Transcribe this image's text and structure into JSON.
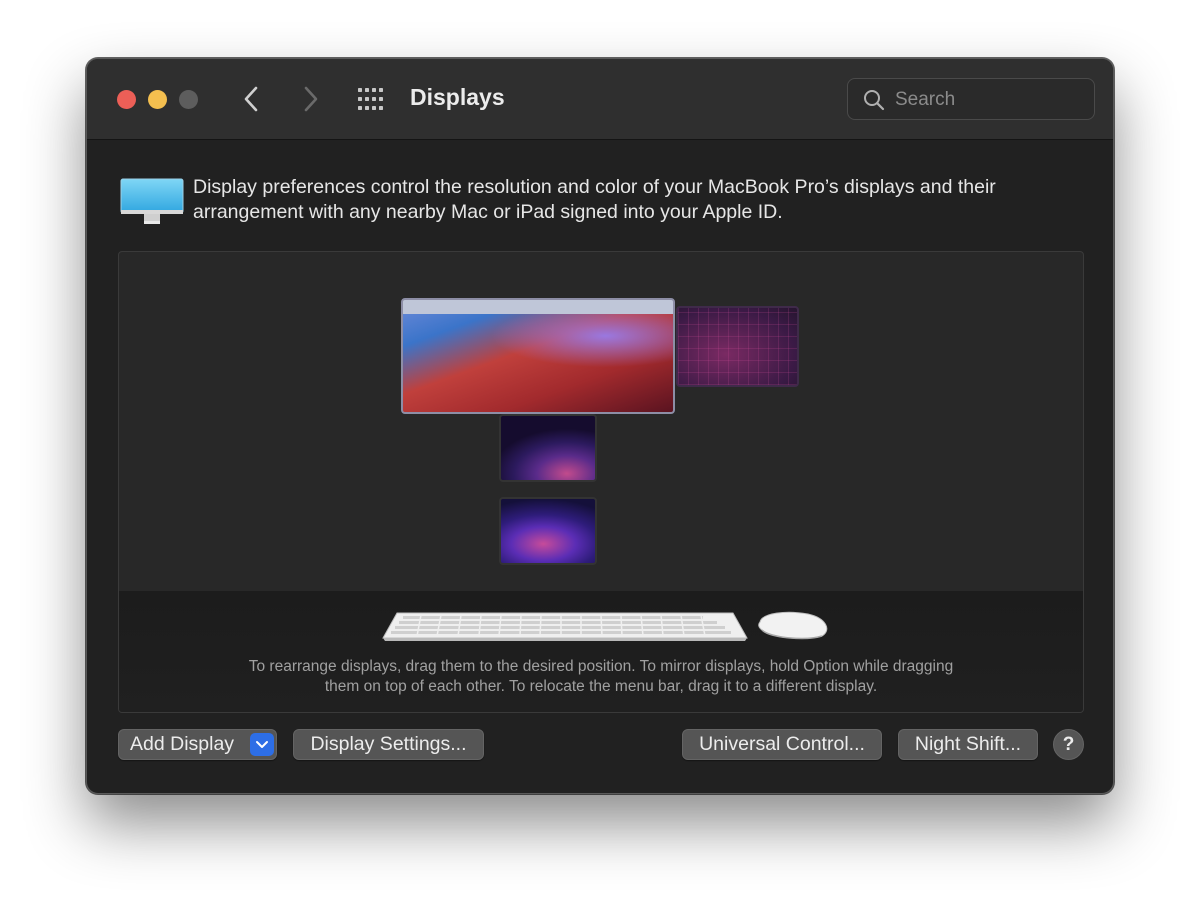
{
  "window": {
    "title": "Displays",
    "traffic_lights": [
      "close",
      "minimize",
      "zoom"
    ]
  },
  "toolbar": {
    "back_icon": "chevron-left-icon",
    "forward_icon": "chevron-right-icon",
    "grid_icon": "show-all-grid-icon",
    "search": {
      "placeholder": "Search",
      "value": ""
    }
  },
  "info": {
    "icon": "display-monitor-icon",
    "text": "Display preferences control the resolution and color of your MacBook Pro’s displays and their arrangement with any nearby Mac or iPad signed into your Apple ID."
  },
  "arrangement": {
    "displays": [
      {
        "name": "main-display",
        "has_menu_bar": true
      },
      {
        "name": "secondary-display"
      },
      {
        "name": "ipad-display-1"
      },
      {
        "name": "ipad-display-2"
      }
    ],
    "instructions_line1": "To rearrange displays, drag them to the desired position. To mirror displays, hold Option while dragging",
    "instructions_line2": "them on top of each other. To relocate the menu bar, drag it to a different display."
  },
  "buttons": {
    "add_display": "Add Display",
    "display_settings": "Display Settings...",
    "universal_control": "Universal Control...",
    "night_shift": "Night Shift...",
    "help": "?"
  },
  "colors": {
    "window_bg": "#212121",
    "titlebar_bg": "#2f2f2f",
    "close": "#ec5f57",
    "minimize": "#f4bf4f",
    "accent": "#2d6ee6"
  }
}
